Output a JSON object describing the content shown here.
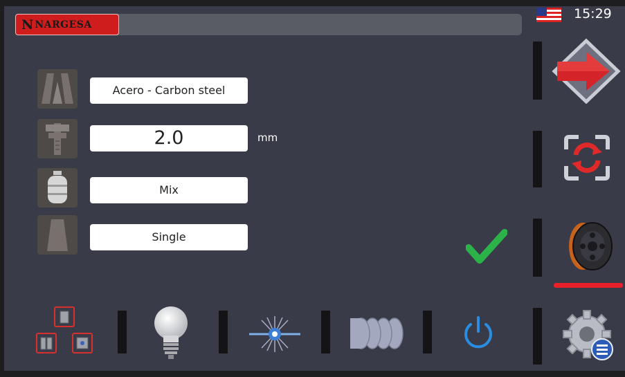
{
  "header": {
    "logo_initial": "N",
    "logo_text": "NARGESA",
    "flag": "us-flag-icon",
    "time": "15:29"
  },
  "parameters": {
    "material": "Acero - Carbon steel",
    "thickness": "2.0",
    "thickness_unit": "mm",
    "gas": "Mix",
    "mode": "Single"
  },
  "icons": {
    "material": "material-profile-icon",
    "thickness": "caliper-icon",
    "gas": "gas-bottle-icon",
    "mode": "nozzle-icon",
    "confirm": "checkmark-icon",
    "next": "next-arrow-icon",
    "change": "swap-icon",
    "wire": "wire-spool-icon",
    "settings": "settings-gear-icon",
    "layout": "layout-tiles-icon",
    "light": "light-bulb-icon",
    "laser": "laser-icon",
    "wobble": "wobble-icon",
    "power": "power-icon"
  },
  "colors": {
    "background": "#393b48",
    "accent_red": "#e8202a",
    "check_green": "#2bb34a",
    "power_blue": "#2a8de0"
  }
}
